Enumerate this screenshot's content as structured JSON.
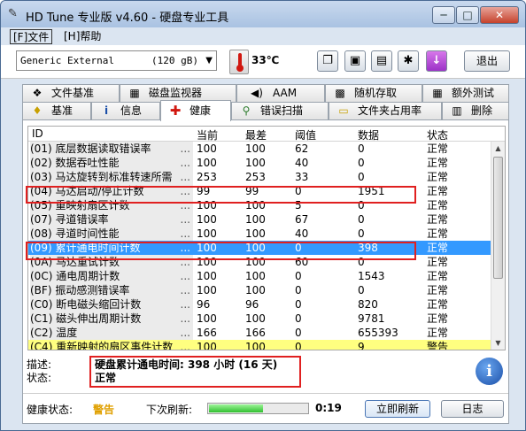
{
  "window": {
    "title": "HD Tune 专业版 v4.60 - 硬盘专业工具",
    "min_glyph": "─",
    "max_glyph": "□",
    "close_glyph": "✕"
  },
  "menu": {
    "file": "[F]文件",
    "help": "[H]帮助"
  },
  "toolbar": {
    "drive": "Generic External",
    "drive_size": "(120 gB)",
    "temperature": "33℃",
    "exit_label": "退出"
  },
  "tabs_row1": [
    {
      "label": "文件基准",
      "icon": "file-benchmark-icon"
    },
    {
      "label": "磁盘监视器",
      "icon": "disk-monitor-icon"
    },
    {
      "label": "AAM",
      "icon": "speaker-icon"
    },
    {
      "label": "随机存取",
      "icon": "random-access-icon"
    },
    {
      "label": "额外测试",
      "icon": "extra-tests-icon"
    }
  ],
  "tabs_row2": [
    {
      "label": "基准",
      "icon": "benchmark-icon"
    },
    {
      "label": "信息",
      "icon": "info-icon"
    },
    {
      "label": "健康",
      "icon": "health-cross-icon"
    },
    {
      "label": "错误扫描",
      "icon": "magnifier-icon"
    },
    {
      "label": "文件夹占用率",
      "icon": "folder-icon"
    },
    {
      "label": "删除",
      "icon": "trash-icon"
    }
  ],
  "table": {
    "columns": [
      "ID",
      "当前",
      "最差",
      "阈值",
      "数据",
      "状态"
    ],
    "rows": [
      {
        "id": "(01) 底层数据读取错误率",
        "cur": "100",
        "worst": "100",
        "thr": "62",
        "data": "0",
        "status": "正常"
      },
      {
        "id": "(02) 数据吞吐性能",
        "cur": "100",
        "worst": "100",
        "thr": "40",
        "data": "0",
        "status": "正常"
      },
      {
        "id": "(03) 马达旋转到标准转速所需",
        "cur": "253",
        "worst": "253",
        "thr": "33",
        "data": "0",
        "status": "正常"
      },
      {
        "id": "(04) 马达启动/停止计数",
        "cur": "99",
        "worst": "99",
        "thr": "0",
        "data": "1951",
        "status": "正常"
      },
      {
        "id": "(05) 重映射扇区计数",
        "cur": "100",
        "worst": "100",
        "thr": "5",
        "data": "0",
        "status": "正常"
      },
      {
        "id": "(07) 寻道错误率",
        "cur": "100",
        "worst": "100",
        "thr": "67",
        "data": "0",
        "status": "正常"
      },
      {
        "id": "(08) 寻道时间性能",
        "cur": "100",
        "worst": "100",
        "thr": "40",
        "data": "0",
        "status": "正常"
      },
      {
        "id": "(09) 累计通电时间计数",
        "cur": "100",
        "worst": "100",
        "thr": "0",
        "data": "398",
        "status": "正常"
      },
      {
        "id": "(0A) 马达重试计数",
        "cur": "100",
        "worst": "100",
        "thr": "60",
        "data": "0",
        "status": "正常"
      },
      {
        "id": "(0C) 通电周期计数",
        "cur": "100",
        "worst": "100",
        "thr": "0",
        "data": "1543",
        "status": "正常"
      },
      {
        "id": "(BF) 振动感测错误率",
        "cur": "100",
        "worst": "100",
        "thr": "0",
        "data": "0",
        "status": "正常"
      },
      {
        "id": "(C0) 断电磁头缩回计数",
        "cur": "96",
        "worst": "96",
        "thr": "0",
        "data": "820",
        "status": "正常"
      },
      {
        "id": "(C1) 磁头伸出周期计数",
        "cur": "100",
        "worst": "100",
        "thr": "0",
        "data": "9781",
        "status": "正常"
      },
      {
        "id": "(C2) 温度",
        "cur": "166",
        "worst": "166",
        "thr": "0",
        "data": "655393",
        "status": "正常"
      },
      {
        "id": "(C4) 重新映射的扇区事件计数",
        "cur": "100",
        "worst": "100",
        "thr": "0",
        "data": "9",
        "status": "警告"
      }
    ],
    "ellipsis": "..."
  },
  "details": {
    "desc_label": "描述:",
    "desc_value": "硬盘累计通电时间: 398 小时 (16 天)",
    "status_label": "状态:",
    "status_value": "正常"
  },
  "footer": {
    "health_label": "健康状态:",
    "health_value": "警告",
    "next_refresh_label": "下次刷新:",
    "refresh_progress": 0.55,
    "countdown": "0:19",
    "refresh_button": "立即刷新",
    "log_button": "日志"
  },
  "colors": {
    "selected_row": "#3399ff",
    "warning_row": "#ffff80",
    "health_warning": "#e0a000",
    "annotation_box": "#e02020"
  }
}
